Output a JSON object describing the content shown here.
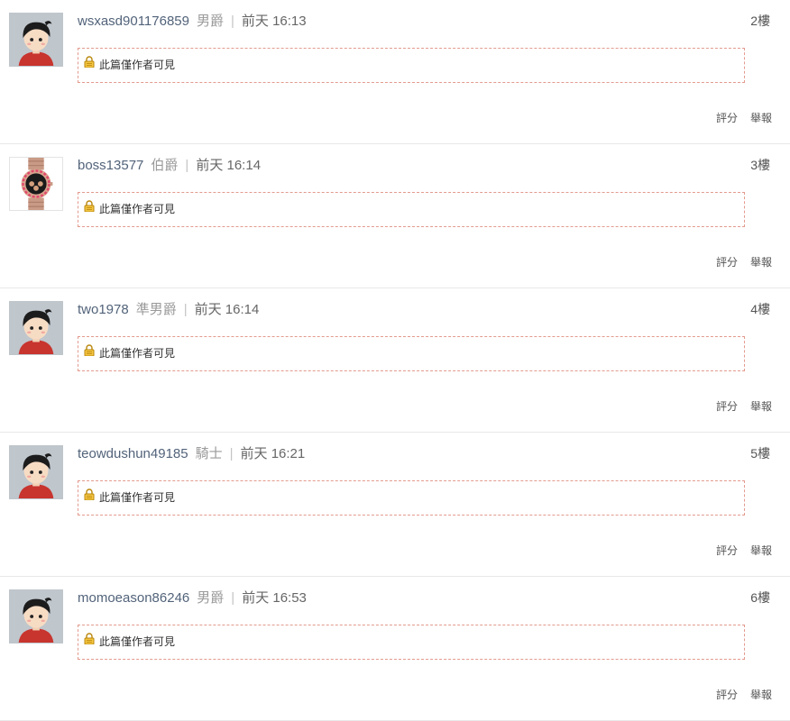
{
  "hidden_text": "此篇僅作者可見",
  "actions": {
    "rate_label": "評分",
    "report_label": "舉報"
  },
  "posts": [
    {
      "username": "wsxasd901176859",
      "rank": "男爵",
      "time": "前天 16:13",
      "floor": "2樓",
      "avatar": "default-avatar"
    },
    {
      "username": "boss13577",
      "rank": "伯爵",
      "time": "前天 16:14",
      "floor": "3樓",
      "avatar": "watch-avatar"
    },
    {
      "username": "two1978",
      "rank": "準男爵",
      "time": "前天 16:14",
      "floor": "4樓",
      "avatar": "default-avatar"
    },
    {
      "username": "teowdushun49185",
      "rank": "騎士",
      "time": "前天 16:21",
      "floor": "5樓",
      "avatar": "default-avatar"
    },
    {
      "username": "momoeason86246",
      "rank": "男爵",
      "time": "前天 16:53",
      "floor": "6樓",
      "avatar": "default-avatar"
    }
  ]
}
